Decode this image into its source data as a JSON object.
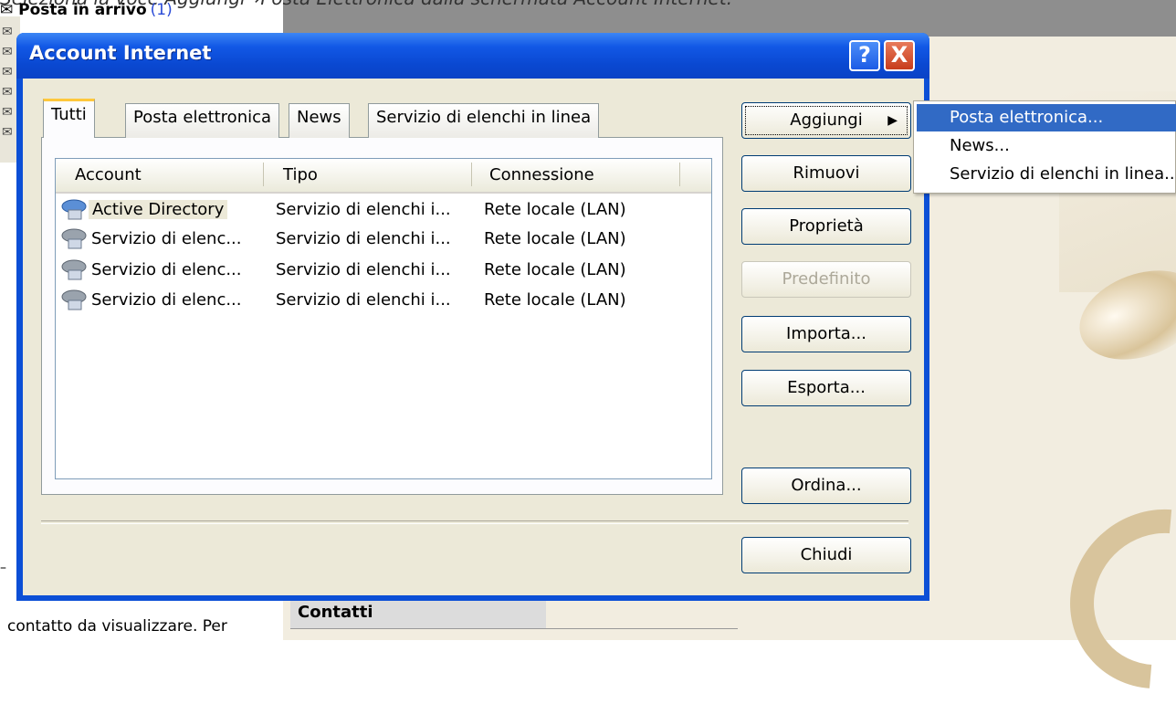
{
  "caption": "Seleziona la voce Aggiungi→Posta Elettronica dalla schermata Account Internet.",
  "background": {
    "inbox_label": "Posta in arrivo",
    "inbox_count": "(1)",
    "contacts_title": "Contatti",
    "contacts_text": "contatto da visualizzare. Per"
  },
  "dialog": {
    "title": "Account Internet",
    "help_glyph": "?",
    "close_glyph": "X",
    "tabs": [
      "Tutti",
      "Posta elettronica",
      "News",
      "Servizio di elenchi in linea"
    ],
    "columns": [
      "Account",
      "Tipo",
      "Connessione"
    ],
    "rows": [
      {
        "account": "Active Directory",
        "type": "Servizio di elenchi i...",
        "connection": "Rete locale (LAN)",
        "icon": "directory-service-icon"
      },
      {
        "account": "Servizio di elenc...",
        "type": "Servizio di elenchi i...",
        "connection": "Rete locale (LAN)",
        "icon": "directory-service-icon"
      },
      {
        "account": "Servizio di elenc...",
        "type": "Servizio di elenchi i...",
        "connection": "Rete locale (LAN)",
        "icon": "directory-service-icon"
      },
      {
        "account": "Servizio di elenc...",
        "type": "Servizio di elenchi i...",
        "connection": "Rete locale (LAN)",
        "icon": "directory-service-icon"
      }
    ],
    "buttons": {
      "add": "Aggiungi",
      "remove": "Rimuovi",
      "properties": "Proprietà",
      "default": "Predefinito",
      "import": "Importa...",
      "export": "Esporta...",
      "order": "Ordina...",
      "close": "Chiudi"
    }
  },
  "add_menu": {
    "items": [
      "Posta elettronica...",
      "News...",
      "Servizio di elenchi in linea..."
    ],
    "highlighted": "Posta elettronica..."
  },
  "colors": {
    "title_bar": "#0a48d1",
    "dialog_face": "#ece9d8",
    "menu_highlight": "#316ac5",
    "close_button": "#c73c1c",
    "tab_accent": "#ffc83c"
  }
}
